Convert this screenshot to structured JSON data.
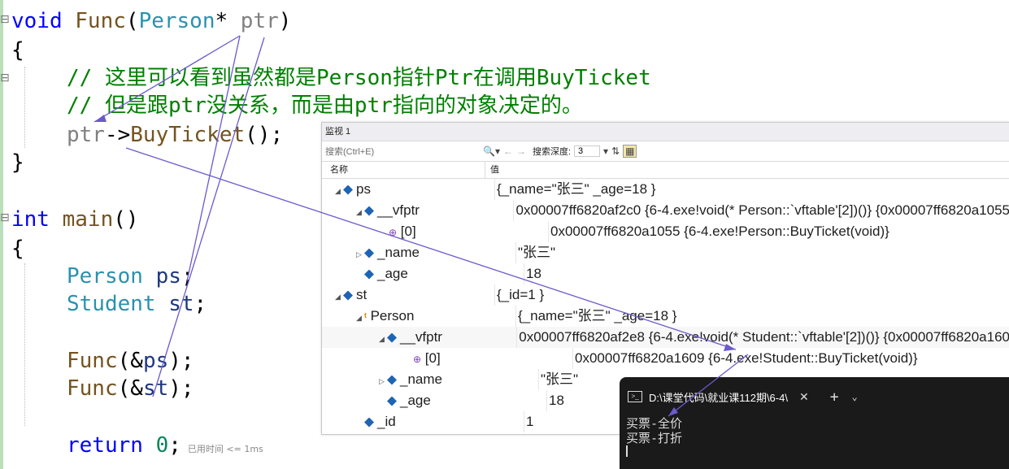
{
  "code": {
    "line1": {
      "kw": "void",
      "fn": "Func",
      "open": "(",
      "type": "Person",
      "star": "* ",
      "param": "ptr",
      "close": ")"
    },
    "brace_open": "{",
    "brace_close": "}",
    "comment1": "// 这里可以看到虽然都是Person指针Ptr在调用BuyTicket",
    "comment2": "// 但是跟ptr没关系，而是由ptr指向的对象决定的。",
    "call": {
      "obj": "ptr",
      "arrow": "->",
      "method": "BuyTicket",
      "tail": "();"
    },
    "main": {
      "kw": "int",
      "fn": "main",
      "parens": "()"
    },
    "decl1": {
      "type": "Person",
      "var": "ps",
      "semi": ";"
    },
    "decl2": {
      "type": "Student",
      "var": "st",
      "semi": ";"
    },
    "call1": {
      "fn": "Func",
      "arg_open": "(&",
      "arg": "ps",
      "tail": ");"
    },
    "call2": {
      "fn": "Func",
      "arg_open": "(&",
      "arg": "st",
      "tail": ");"
    },
    "ret": {
      "kw": "return",
      "val": "0",
      "semi": ";",
      "elapsed": "已用时间 <= 1ms"
    }
  },
  "watch": {
    "title": "监视 1",
    "search_placeholder": "搜索(Ctrl+E)",
    "search_icon": "🔍▾",
    "depth_label": "搜索深度:",
    "depth_value": "3",
    "col_name": "名称",
    "col_value": "值",
    "rows": [
      {
        "name": "ps",
        "value": "{_name=\"张三\" _age=18 }"
      },
      {
        "name": "__vfptr",
        "value": "0x00007ff6820af2c0 {6-4.exe!void(* Person::`vftable'[2])()} {0x00007ff6820a1055"
      },
      {
        "name": "[0]",
        "value": "0x00007ff6820a1055 {6-4.exe!Person::BuyTicket(void)}"
      },
      {
        "name": "_name",
        "value": "\"张三\""
      },
      {
        "name": "_age",
        "value": "18"
      },
      {
        "name": "st",
        "value": "{_id=1 }"
      },
      {
        "name": "Person",
        "value": "{_name=\"张三\" _age=18 }"
      },
      {
        "name": "__vfptr",
        "value": "0x00007ff6820af2e8 {6-4.exe!void(* Student::`vftable'[2])()} {0x00007ff6820a160"
      },
      {
        "name": "[0]",
        "value": "0x00007ff6820a1609 {6-4.exe!Student::BuyTicket(void)}"
      },
      {
        "name": "_name",
        "value": "\"张三\""
      },
      {
        "name": "_age",
        "value": "18"
      },
      {
        "name": "_id",
        "value": "1"
      }
    ]
  },
  "terminal": {
    "tab_title": "D:\\课堂代码\\就业课112期\\6-4\\",
    "close": "✕",
    "plus": "+",
    "chevron": "⌄",
    "lines": [
      "买票-全价",
      "买票-打折"
    ]
  },
  "colors": {
    "keyword": "#0000ff",
    "type": "#2b91af",
    "comment": "#008000",
    "annotation": "#6a5acd"
  }
}
